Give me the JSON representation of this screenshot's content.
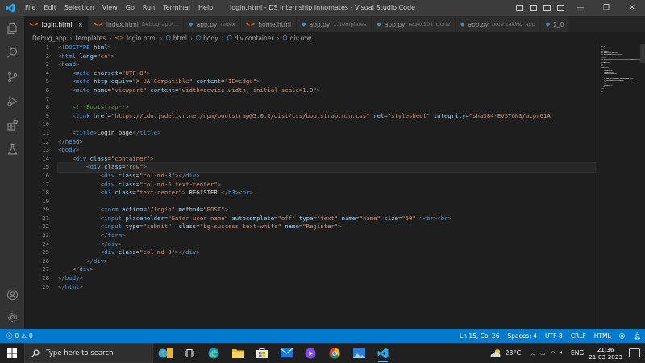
{
  "titlebar": {
    "menu": [
      "File",
      "Edit",
      "Selection",
      "View",
      "Go",
      "Run",
      "Terminal",
      "Help"
    ],
    "title": "login.html - DS Internship Innomates - Visual Studio Code",
    "controls": {
      "minimize": "—",
      "maximize": "❐",
      "close": "✕"
    }
  },
  "tabs": [
    {
      "icon": "<>",
      "label": "login.html",
      "desc": "",
      "active": true,
      "close": "×"
    },
    {
      "icon": "<>",
      "label": "index.html",
      "desc": "Debug_app\\...",
      "active": false
    },
    {
      "icon": "◆",
      "label": "app.py",
      "desc": "regex",
      "active": false
    },
    {
      "icon": "<>",
      "label": "home.html",
      "desc": "",
      "active": false
    },
    {
      "icon": "◆",
      "label": "app.py",
      "desc": "...\\templates",
      "active": false
    },
    {
      "icon": "◆",
      "label": "app.py",
      "desc": "regex101_clone",
      "active": false
    },
    {
      "icon": "◆",
      "label": "app.py",
      "desc": "note_taking_app",
      "active": false
    },
    {
      "icon": "◆",
      "label": "2_0",
      "desc": "",
      "active": false
    }
  ],
  "breadcrumb": [
    "Debug_app",
    "templates",
    "login.html",
    "html",
    "body",
    "div.container",
    "div.row"
  ],
  "editor": {
    "current_line": 15
  },
  "statusbar": {
    "problems": "0",
    "warnings": "0",
    "position": "Ln 15, Col 26",
    "spaces": "Spaces: 4",
    "encoding": "UTF-8",
    "eol": "CRLF",
    "language": "HTML"
  },
  "taskbar": {
    "search_placeholder": "Type here to search",
    "temperature": "23°C",
    "language": "ENG",
    "time": "21:36",
    "date": "21-03-2023"
  },
  "colors": {
    "accent": "#007acc",
    "titlebar": "#3c3c3c",
    "editor_bg": "#1e1e1e"
  }
}
